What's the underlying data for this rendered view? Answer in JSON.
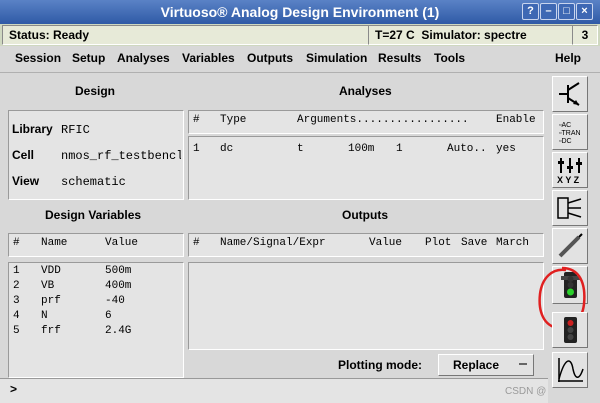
{
  "window": {
    "title": "Virtuoso® Analog Design Environment (1)",
    "controls": [
      "?",
      "–",
      "□",
      "×"
    ]
  },
  "status": {
    "text": "Status: Ready",
    "temp": "T=27 C",
    "simulator": "Simulator: spectre",
    "session_num": "3"
  },
  "menu": [
    "Session",
    "Setup",
    "Analyses",
    "Variables",
    "Outputs",
    "Simulation",
    "Results",
    "Tools",
    "Help"
  ],
  "design": {
    "header": "Design",
    "library_label": "Library",
    "library_value": "RFIC",
    "cell_label": "Cell",
    "cell_value": "nmos_rf_testbencl",
    "view_label": "View",
    "view_value": "schematic"
  },
  "analyses": {
    "header": "Analyses",
    "columns": [
      "#",
      "Type",
      "Arguments.................",
      "Enable"
    ],
    "rows": [
      {
        "num": "1",
        "type": "dc",
        "a1": "t",
        "a2": "100m",
        "a3": "1",
        "a4": "Auto..",
        "enable": "yes"
      }
    ]
  },
  "design_variables": {
    "header": "Design Variables",
    "columns": [
      "#",
      "Name",
      "Value"
    ],
    "rows": [
      {
        "num": "1",
        "name": "VDD",
        "value": "500m"
      },
      {
        "num": "2",
        "name": "VB",
        "value": "400m"
      },
      {
        "num": "3",
        "name": "prf",
        "value": "-40"
      },
      {
        "num": "4",
        "name": "N",
        "value": "6"
      },
      {
        "num": "5",
        "name": "frf",
        "value": "2.4G"
      }
    ]
  },
  "outputs": {
    "header": "Outputs",
    "columns": [
      "#",
      "Name/Signal/Expr",
      "Value",
      "Plot",
      "Save",
      "March"
    ]
  },
  "plotting": {
    "label": "Plotting mode:",
    "value": "Replace"
  },
  "prompt": ">",
  "watermark": "CSDN @"
}
